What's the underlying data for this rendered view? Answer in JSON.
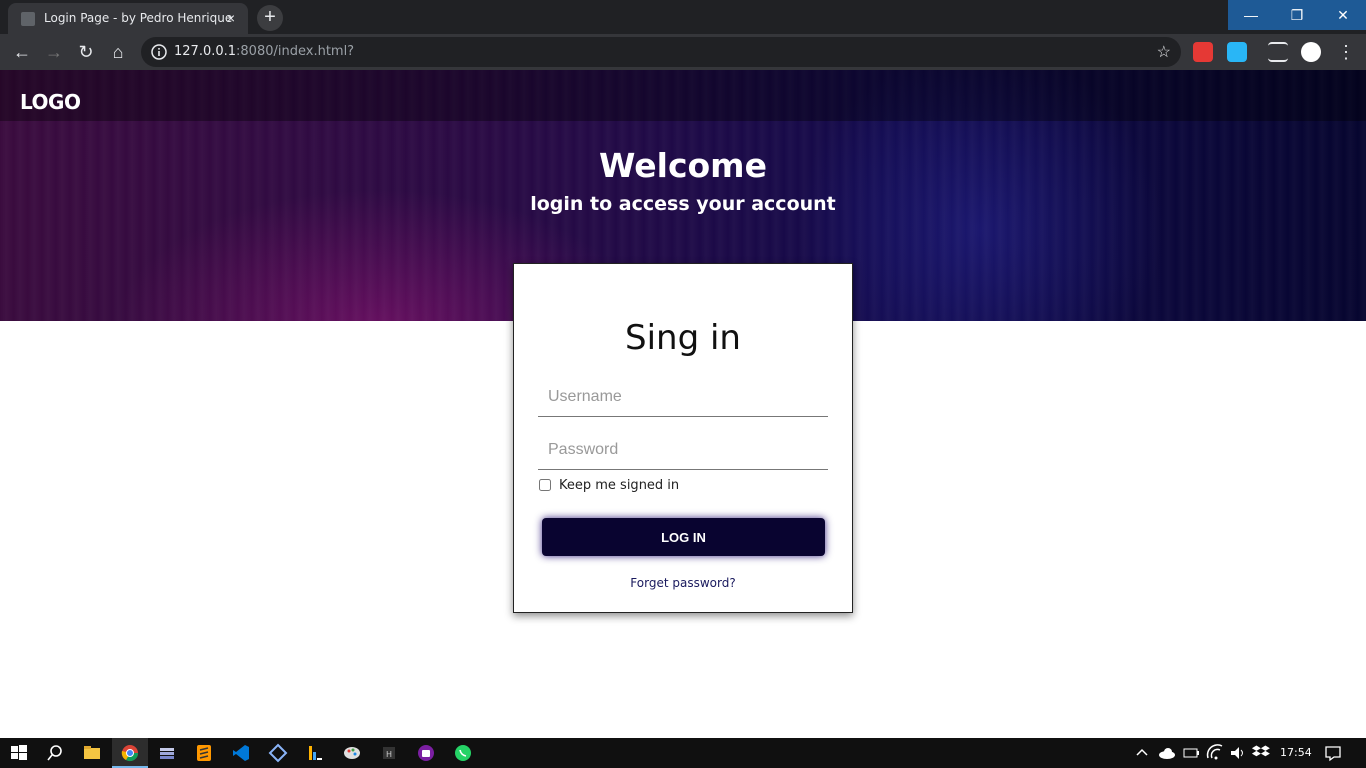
{
  "browser": {
    "tab_title": "Login Page - by Pedro Henrique",
    "tab_close": "×",
    "new_tab": "+",
    "window_minimize": "—",
    "window_restore": "❐",
    "window_close": "✕",
    "url_host": "127.0.0.1",
    "url_path": ":8080/index.html?",
    "back": "←",
    "forward": "→",
    "reload": "↻",
    "home": "⌂",
    "star": "☆",
    "menu": "⋮"
  },
  "page": {
    "logo": "LOGO",
    "welcome": "Welcome",
    "subtitle": "login to access your account",
    "card_title": "Sing in",
    "username_placeholder": "Username",
    "password_placeholder": "Password",
    "keep_signed_in": "Keep me signed in",
    "login_button": "LOG IN",
    "forget_password": "Forget password?"
  },
  "taskbar": {
    "clock": "17:54"
  },
  "colors": {
    "accent_button": "#090430",
    "hero_left": "#3a0b3e",
    "hero_right": "#06052f"
  }
}
